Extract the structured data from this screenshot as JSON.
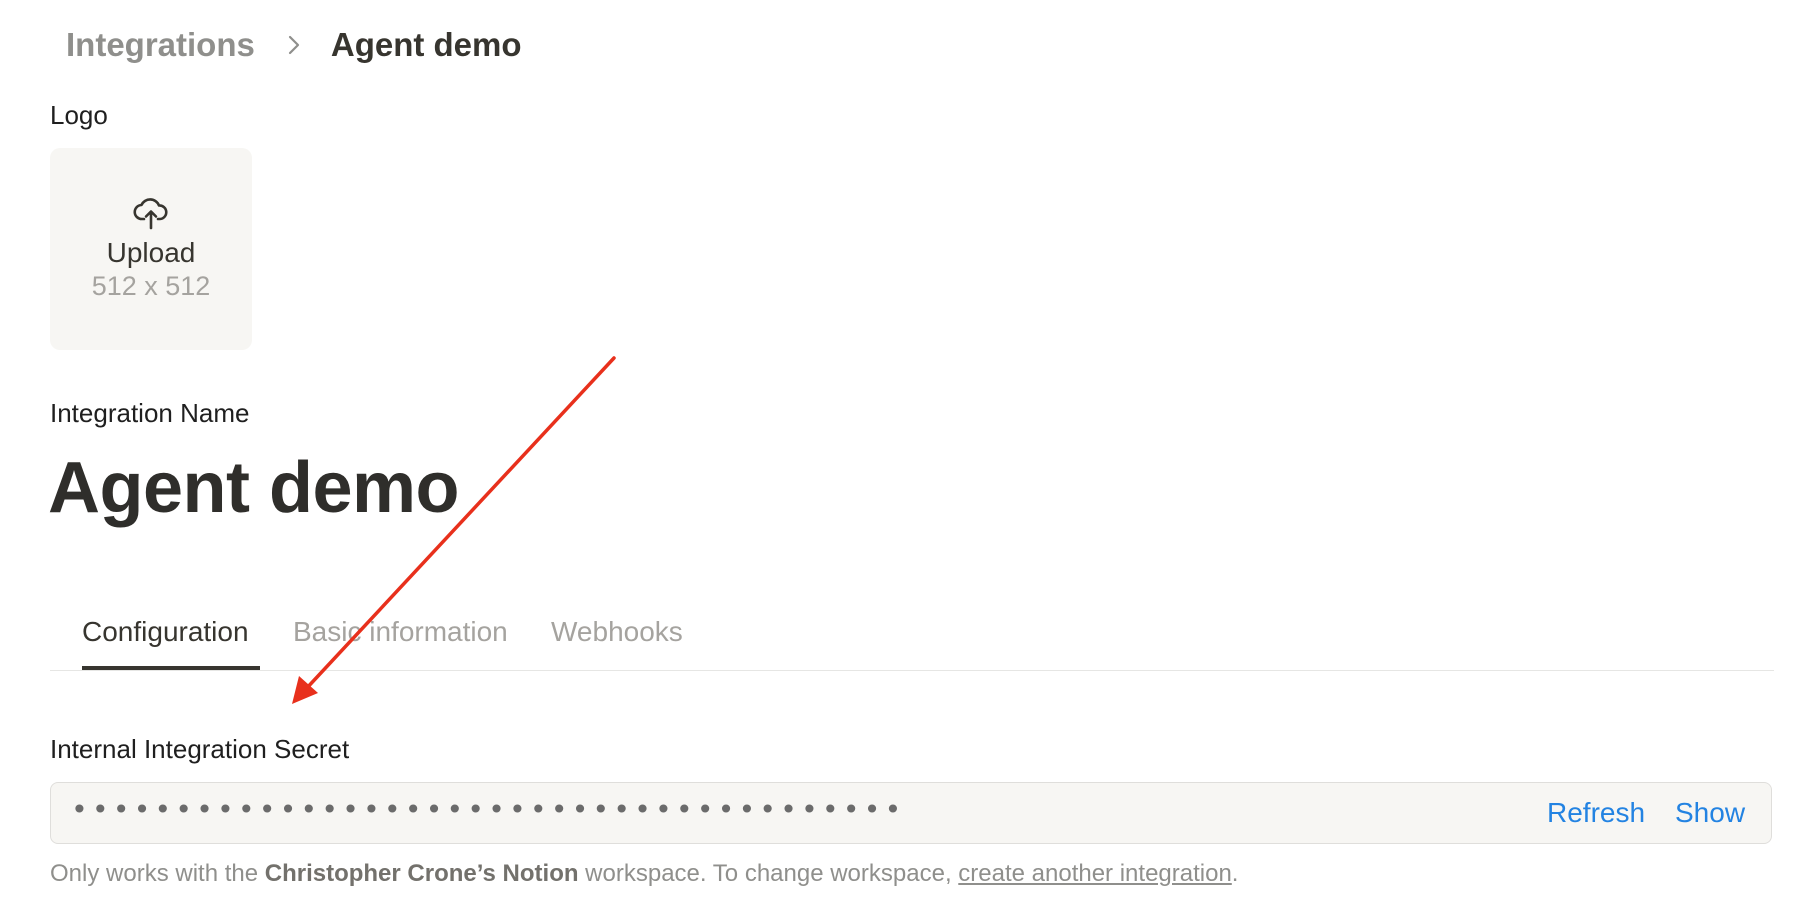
{
  "breadcrumb": {
    "parent": "Integrations",
    "current": "Agent demo"
  },
  "logo": {
    "label": "Logo",
    "upload_text": "Upload",
    "size_hint": "512 x 512",
    "icon": "cloud-upload-icon"
  },
  "integration": {
    "name_label": "Integration Name",
    "name_value": "Agent demo"
  },
  "tabs": [
    {
      "label": "Configuration",
      "active": true
    },
    {
      "label": "Basic information",
      "active": false
    },
    {
      "label": "Webhooks",
      "active": false
    }
  ],
  "secret": {
    "label": "Internal Integration Secret",
    "masked_value": "••••••••••••••••••••••••••••••••••••••••",
    "refresh_label": "Refresh",
    "show_label": "Show"
  },
  "footnote": {
    "prefix": "Only works with the ",
    "workspace": "Christopher Crone’s Notion",
    "middle": " workspace. To change workspace, ",
    "link": "create another integration",
    "suffix": "."
  },
  "colors": {
    "accent": "#2383e2",
    "annotation_arrow": "#e8301c",
    "field_background": "#f7f6f3"
  }
}
